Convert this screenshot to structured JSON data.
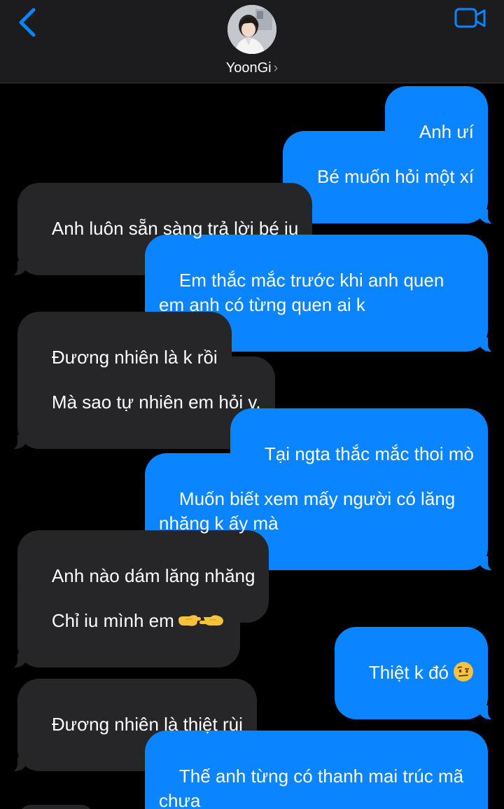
{
  "header": {
    "contact_name": "YoonGi",
    "chevron": "›",
    "icons": {
      "back": "chevron-left-icon",
      "video": "video-camera-icon"
    },
    "accent_color": "#0a84ff"
  },
  "messages": [
    {
      "side": "sent",
      "text": "Anh ưí"
    },
    {
      "side": "sent",
      "text": "Bé muốn hỏi một xí"
    },
    {
      "side": "received",
      "text": "Anh luôn sẵn sàng trả lời bé iu"
    },
    {
      "side": "sent",
      "text": "Em thắc mắc trước khi anh quen em anh có từng quen ai k"
    },
    {
      "side": "received",
      "text": "Đương nhiên là k rồi"
    },
    {
      "side": "received",
      "text": "Mà sao tự nhiên em hỏi v."
    },
    {
      "side": "sent",
      "text": "Tại ngta thắc mắc thoi mò"
    },
    {
      "side": "sent",
      "text": "Muốn biết xem mấy người có lăng nhăng k ấy mà"
    },
    {
      "side": "received",
      "text": "Anh nào dám lăng nhăng"
    },
    {
      "side": "received",
      "text": "Chỉ iu mình em",
      "emoji": "pointing-hands-emoji"
    },
    {
      "side": "sent",
      "text": "Thiệt k đó",
      "emoji": "raised-eyebrow-face-emoji"
    },
    {
      "side": "received",
      "text": "Đương nhiên là thiệt rùi"
    },
    {
      "side": "sent",
      "text": "Thế anh từng có thanh mai trúc mã chưa"
    }
  ]
}
